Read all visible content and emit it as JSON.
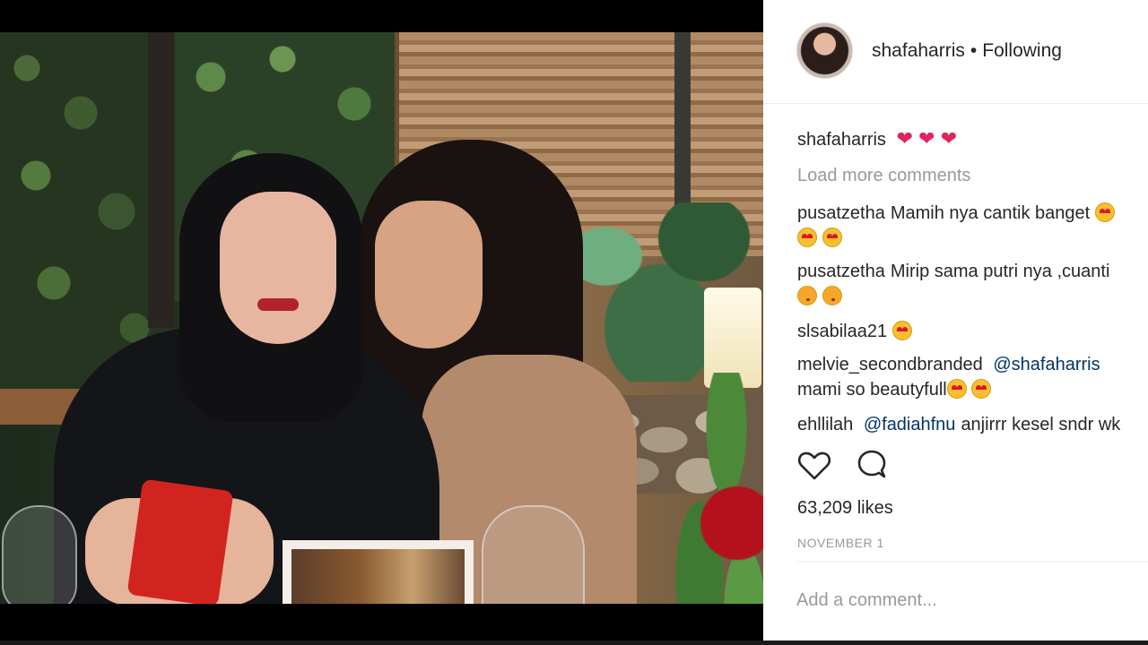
{
  "post": {
    "username": "shafaharris",
    "separator": "•",
    "follow_status": "Following",
    "caption_user": "shafaharris",
    "caption_emoji": "❤ ❤ ❤",
    "load_more": "Load more comments",
    "likes": "63,209 likes",
    "date": "NOVEMBER 1",
    "add_comment_placeholder": "Add a comment..."
  },
  "comments": [
    {
      "user": "pusatzetha",
      "text": "Mamih nya cantik banget",
      "emoji": "love"
    },
    {
      "user": "pusatzetha",
      "text": "Mirip sama putri nya ,cuanti",
      "emoji": "kiss"
    },
    {
      "user": "slsabilaa21",
      "text": "",
      "emoji": "love"
    },
    {
      "user": "melvie_secondbranded",
      "mention": "@shafaharris",
      "text2": "mami so beautyfull",
      "emoji": "love"
    },
    {
      "user": "ehllilah",
      "mention": "@fadiahfnu",
      "text": "anjirrr kesel sndr wk"
    }
  ],
  "icons": {
    "like": "heart-outline-icon",
    "comment": "speech-bubble-icon"
  },
  "colors": {
    "mention": "#003569",
    "muted": "#999999",
    "text": "#262626"
  }
}
